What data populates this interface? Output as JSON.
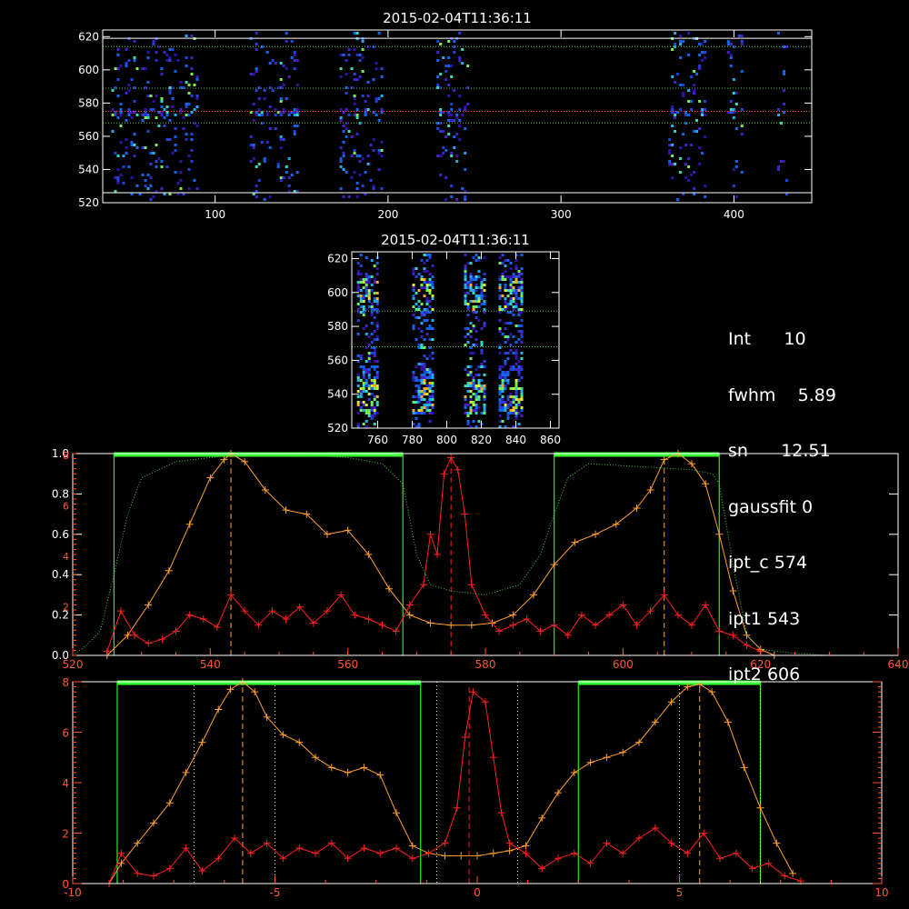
{
  "colors": {
    "background": "#000000",
    "axis": "#ffffff",
    "line_core": "#ff2020",
    "line_total": "#ffa030",
    "band": "#22ee22",
    "band_bar": "#33ff33",
    "guide": "#ffff66",
    "guide_red": "#ff4040",
    "dotted_green": "#44cc44",
    "axis_red": "#ff5533"
  },
  "panels": {
    "top": {
      "title": "2015-02-04T11:36:11"
    },
    "middle": {
      "title": "2015-02-04T11:36:11"
    }
  },
  "info": {
    "lines": [
      {
        "label": "Int",
        "value": "10"
      },
      {
        "label": "fwhm",
        "value": "5.89"
      },
      {
        "label": "sn",
        "value": "12.51"
      },
      {
        "label": "gaussfit",
        "value": "0"
      },
      {
        "label": "ipt_c",
        "value": "574"
      },
      {
        "label": "ipt1",
        "value": "543"
      },
      {
        "label": "ipt2",
        "value": "606"
      }
    ]
  },
  "chart_data": [
    {
      "type": "heatmap",
      "panel": "top",
      "title": "2015-02-04T11:36:11",
      "xlim": [
        35,
        445
      ],
      "ylim": [
        520,
        624
      ],
      "xticks": [
        100,
        200,
        300,
        400
      ],
      "yticks": [
        520,
        540,
        560,
        580,
        600,
        620
      ],
      "columns": [
        [
          40,
          90
        ],
        [
          120,
          148
        ],
        [
          172,
          196
        ],
        [
          228,
          246
        ],
        [
          362,
          384
        ],
        [
          396,
          404
        ],
        [
          425,
          430
        ]
      ],
      "hlines": [
        {
          "y": 575,
          "style": "red-dotted"
        },
        {
          "y": 589,
          "style": "green-dotted"
        },
        {
          "y": 568,
          "style": "green-dotted"
        },
        {
          "y": 614,
          "style": "green-dotted"
        },
        {
          "y": 526,
          "style": "white"
        },
        {
          "y": 619,
          "style": "white"
        }
      ]
    },
    {
      "type": "heatmap",
      "panel": "middle",
      "title": "2015-02-04T11:36:11",
      "xlim": [
        745,
        865
      ],
      "ylim": [
        520,
        624
      ],
      "xticks": [
        760,
        780,
        800,
        820,
        840,
        860
      ],
      "yticks": [
        520,
        540,
        560,
        580,
        600,
        620
      ],
      "columns": [
        [
          748,
          760
        ],
        [
          780,
          792
        ],
        [
          810,
          822
        ],
        [
          830,
          844
        ]
      ],
      "hlines": [
        {
          "y": 589,
          "style": "green-dotted"
        },
        {
          "y": 568,
          "style": "green-dotted"
        }
      ]
    },
    {
      "type": "line",
      "panel": "spectrum",
      "xlim": [
        520,
        640
      ],
      "ylim": [
        0,
        1.0
      ],
      "right_ylim": [
        0,
        8
      ],
      "xticks": [
        520,
        540,
        560,
        580,
        600,
        620,
        640
      ],
      "yticks_left": [
        "0.0",
        "0.2",
        "0.4",
        "0.6",
        "0.8",
        "1.0"
      ],
      "yticks_red": [
        "2",
        "4",
        "6",
        "8"
      ],
      "band_lines": [
        526,
        568,
        590,
        614
      ],
      "dashed": [
        543,
        575,
        606
      ],
      "series": [
        {
          "color": "line_total",
          "x": [
            525,
            528,
            531,
            534,
            537,
            540,
            542,
            543,
            545,
            548,
            551,
            554,
            557,
            560,
            563,
            566,
            569,
            572,
            575,
            578,
            581,
            584,
            587,
            590,
            593,
            596,
            599,
            602,
            604,
            606,
            608,
            610,
            612,
            614,
            616,
            618,
            620,
            622
          ],
          "y": [
            0.0,
            0.1,
            0.25,
            0.42,
            0.65,
            0.88,
            0.97,
            1.0,
            0.96,
            0.82,
            0.72,
            0.7,
            0.6,
            0.62,
            0.5,
            0.33,
            0.2,
            0.16,
            0.15,
            0.15,
            0.16,
            0.2,
            0.3,
            0.45,
            0.56,
            0.6,
            0.65,
            0.73,
            0.82,
            0.97,
            1.0,
            0.95,
            0.85,
            0.6,
            0.32,
            0.1,
            0.03,
            0.0
          ]
        },
        {
          "color": "line_core",
          "x": [
            525,
            527,
            529,
            531,
            533,
            535,
            537,
            539,
            541,
            543,
            545,
            547,
            549,
            551,
            553,
            555,
            557,
            559,
            561,
            563,
            565,
            567,
            569,
            571,
            572,
            573,
            574,
            575,
            576,
            577,
            578,
            580,
            582,
            584,
            586,
            588,
            590,
            592,
            594,
            596,
            598,
            600,
            602,
            604,
            606,
            608,
            610,
            612,
            614,
            616,
            618,
            620
          ],
          "y": [
            0.02,
            0.22,
            0.1,
            0.06,
            0.08,
            0.12,
            0.2,
            0.18,
            0.14,
            0.3,
            0.22,
            0.15,
            0.22,
            0.18,
            0.24,
            0.16,
            0.22,
            0.3,
            0.2,
            0.18,
            0.15,
            0.12,
            0.25,
            0.35,
            0.6,
            0.5,
            0.9,
            0.98,
            0.92,
            0.7,
            0.35,
            0.2,
            0.12,
            0.15,
            0.18,
            0.12,
            0.15,
            0.1,
            0.2,
            0.15,
            0.2,
            0.25,
            0.15,
            0.22,
            0.3,
            0.2,
            0.15,
            0.25,
            0.12,
            0.1,
            0.05,
            0.02
          ]
        },
        {
          "color": "dotted_green",
          "dotted": true,
          "x": [
            520,
            522,
            524,
            526,
            528,
            530,
            535,
            540,
            545,
            550,
            555,
            560,
            565,
            568,
            570,
            572,
            575,
            580,
            585,
            588,
            590,
            592,
            595,
            600,
            605,
            610,
            613,
            614,
            616,
            618,
            620,
            625,
            630,
            635,
            640
          ],
          "y": [
            0.0,
            0.05,
            0.12,
            0.4,
            0.7,
            0.88,
            0.96,
            0.98,
            1.0,
            1.0,
            0.99,
            0.98,
            0.95,
            0.85,
            0.5,
            0.35,
            0.32,
            0.3,
            0.35,
            0.5,
            0.7,
            0.88,
            0.95,
            0.94,
            0.93,
            0.92,
            0.9,
            0.85,
            0.45,
            0.1,
            0.03,
            0.01,
            0.0,
            0.0,
            0.0
          ]
        }
      ]
    },
    {
      "type": "line",
      "panel": "velocity",
      "xlim": [
        -10,
        10
      ],
      "ylim": [
        0,
        8
      ],
      "xticks": [
        -10,
        -5,
        0,
        5,
        10
      ],
      "yticks": [
        "0",
        "2",
        "4",
        "6",
        "8"
      ],
      "band_lines": [
        -8.9,
        -1.4,
        2.5,
        7.0
      ],
      "dotted_guides": [
        -7,
        -5,
        -1,
        1,
        5,
        7
      ],
      "dashed": [
        -5.8,
        -0.2,
        5.5
      ],
      "series": [
        {
          "color": "line_total",
          "x": [
            -9.1,
            -8.8,
            -8.4,
            -8.0,
            -7.6,
            -7.2,
            -6.8,
            -6.4,
            -6.1,
            -5.8,
            -5.5,
            -5.2,
            -4.8,
            -4.4,
            -4.0,
            -3.6,
            -3.2,
            -2.8,
            -2.4,
            -2.0,
            -1.6,
            -1.2,
            -0.8,
            -0.4,
            0.0,
            0.4,
            0.8,
            1.2,
            1.6,
            2.0,
            2.4,
            2.8,
            3.2,
            3.6,
            4.0,
            4.4,
            4.8,
            5.2,
            5.5,
            5.8,
            6.2,
            6.6,
            7.0,
            7.4,
            7.8
          ],
          "y": [
            0.0,
            0.8,
            1.6,
            2.4,
            3.2,
            4.4,
            5.6,
            6.9,
            7.7,
            8.0,
            7.6,
            6.6,
            5.9,
            5.6,
            5.0,
            4.6,
            4.4,
            4.6,
            4.3,
            2.8,
            1.5,
            1.2,
            1.1,
            1.1,
            1.1,
            1.2,
            1.3,
            1.5,
            2.6,
            3.6,
            4.4,
            4.8,
            5.0,
            5.2,
            5.6,
            6.4,
            7.2,
            7.8,
            7.9,
            7.6,
            6.4,
            4.6,
            3.0,
            1.6,
            0.4
          ]
        },
        {
          "color": "line_core",
          "x": [
            -9.1,
            -8.8,
            -8.4,
            -8.0,
            -7.6,
            -7.2,
            -6.8,
            -6.4,
            -6.0,
            -5.6,
            -5.2,
            -4.8,
            -4.4,
            -4.0,
            -3.6,
            -3.2,
            -2.8,
            -2.4,
            -2.0,
            -1.6,
            -1.2,
            -0.8,
            -0.5,
            -0.3,
            -0.1,
            0.2,
            0.4,
            0.6,
            0.8,
            1.2,
            1.6,
            2.0,
            2.4,
            2.8,
            3.2,
            3.6,
            4.0,
            4.4,
            4.8,
            5.2,
            5.6,
            6.0,
            6.4,
            6.8,
            7.2,
            7.6,
            8.0
          ],
          "y": [
            0.0,
            1.2,
            0.4,
            0.3,
            0.6,
            1.4,
            0.5,
            1.0,
            1.8,
            1.2,
            1.6,
            1.0,
            1.4,
            1.2,
            1.6,
            1.0,
            1.4,
            1.2,
            1.4,
            1.0,
            1.2,
            1.6,
            3.0,
            5.8,
            7.6,
            7.2,
            5.0,
            2.8,
            1.6,
            1.2,
            0.6,
            1.0,
            1.2,
            0.8,
            1.6,
            1.2,
            1.8,
            2.2,
            1.6,
            1.2,
            2.0,
            1.0,
            1.2,
            0.6,
            0.8,
            0.3,
            0.1
          ]
        }
      ]
    }
  ]
}
